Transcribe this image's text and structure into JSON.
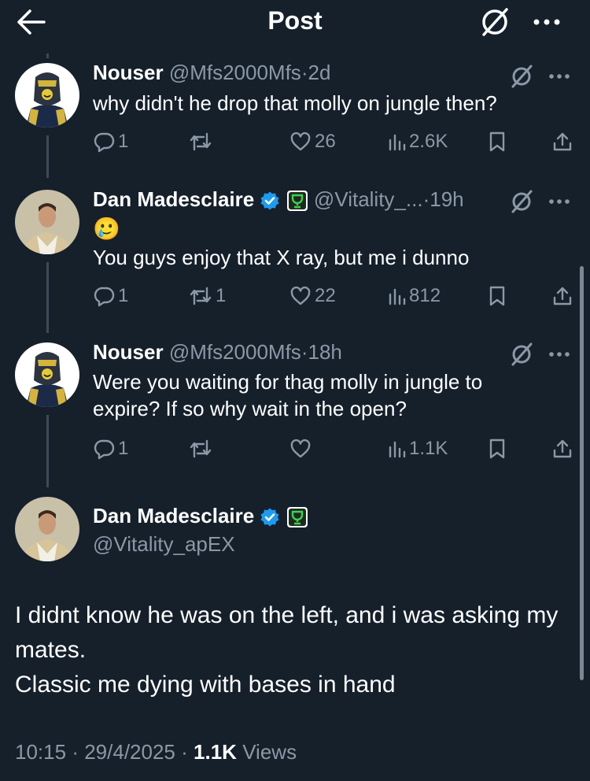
{
  "header": {
    "title": "Post"
  },
  "replies": [
    {
      "name": "Nouser",
      "handle": "@Mfs2000Mfs",
      "sep": "·",
      "time": "2d",
      "text": "why didn't he drop that molly on jungle then?",
      "reply_count": "1",
      "retweet_count": "",
      "like_count": "26",
      "views": "2.6K"
    },
    {
      "name": "Dan Madesclaire",
      "handle": "@Vitality_...",
      "sep": "·",
      "time": "19h",
      "emoji": "🥲",
      "text": "You guys enjoy that X ray, but me i dunno",
      "reply_count": "1",
      "retweet_count": "1",
      "like_count": "22",
      "views": "812"
    },
    {
      "name": "Nouser",
      "handle": "@Mfs2000Mfs",
      "sep": "·",
      "time": "18h",
      "text": "Were you waiting for thag molly in jungle to expire? If so why wait in the open?",
      "reply_count": "1",
      "retweet_count": "",
      "like_count": "",
      "views": "1.1K"
    }
  ],
  "main_post": {
    "name": "Dan Madesclaire",
    "handle": "@Vitality_apEX",
    "text_line1": "I didnt know he was on the left, and i was asking my mates.",
    "text_line2": "Classic me dying with bases in hand",
    "time": "10:15",
    "date": "29/4/2025",
    "views_count": "1.1K",
    "views_label": "Views",
    "sep": "·"
  },
  "colors": {
    "background": "#15202b",
    "muted": "#8b98a5",
    "verified": "#1d9bf0",
    "affiliate_badge": "#39d353"
  },
  "icons": [
    "back-arrow-icon",
    "grok-icon",
    "more-icon",
    "reply-icon",
    "retweet-icon",
    "like-icon",
    "views-icon",
    "bookmark-icon",
    "share-icon",
    "verified-icon",
    "affiliate-badge-icon"
  ]
}
